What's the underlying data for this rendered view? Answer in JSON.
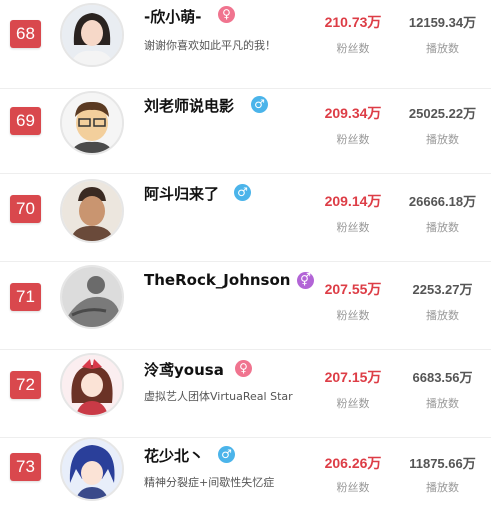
{
  "labels": {
    "fans": "粉丝数",
    "plays": "播放数"
  },
  "rows": [
    {
      "rank": "68",
      "name": "-欣小萌-",
      "gender": "female",
      "signature": "谢谢你喜欢如此平凡的我！",
      "fans": "210.73万",
      "plays": "12159.34万"
    },
    {
      "rank": "69",
      "name": "刘老师说电影",
      "gender": "male",
      "signature": "",
      "fans": "209.34万",
      "plays": "25025.22万"
    },
    {
      "rank": "70",
      "name": "阿斗归来了",
      "gender": "male",
      "signature": "",
      "fans": "209.14万",
      "plays": "26666.18万"
    },
    {
      "rank": "71",
      "name": "TheRock_Johnson",
      "gender": "other",
      "signature": "",
      "fans": "207.55万",
      "plays": "2253.27万"
    },
    {
      "rank": "72",
      "name": "泠鸢yousa",
      "gender": "female",
      "signature": "虚拟艺人团体VirtuaReal Star",
      "fans": "207.15万",
      "plays": "6683.56万"
    },
    {
      "rank": "73",
      "name": "花少北丶",
      "gender": "male",
      "signature": "精神分裂症+间歇性失忆症",
      "fans": "206.26万",
      "plays": "11875.66万"
    }
  ],
  "colors": {
    "rank_bg": "#d9484d",
    "fans_text": "#dd3d46",
    "female": "#f0748f",
    "male": "#4bb4ea",
    "other": "#b264d6"
  },
  "icons": {
    "female": "female-sign-icon",
    "male": "male-sign-icon",
    "other": "secret-gender-icon"
  }
}
